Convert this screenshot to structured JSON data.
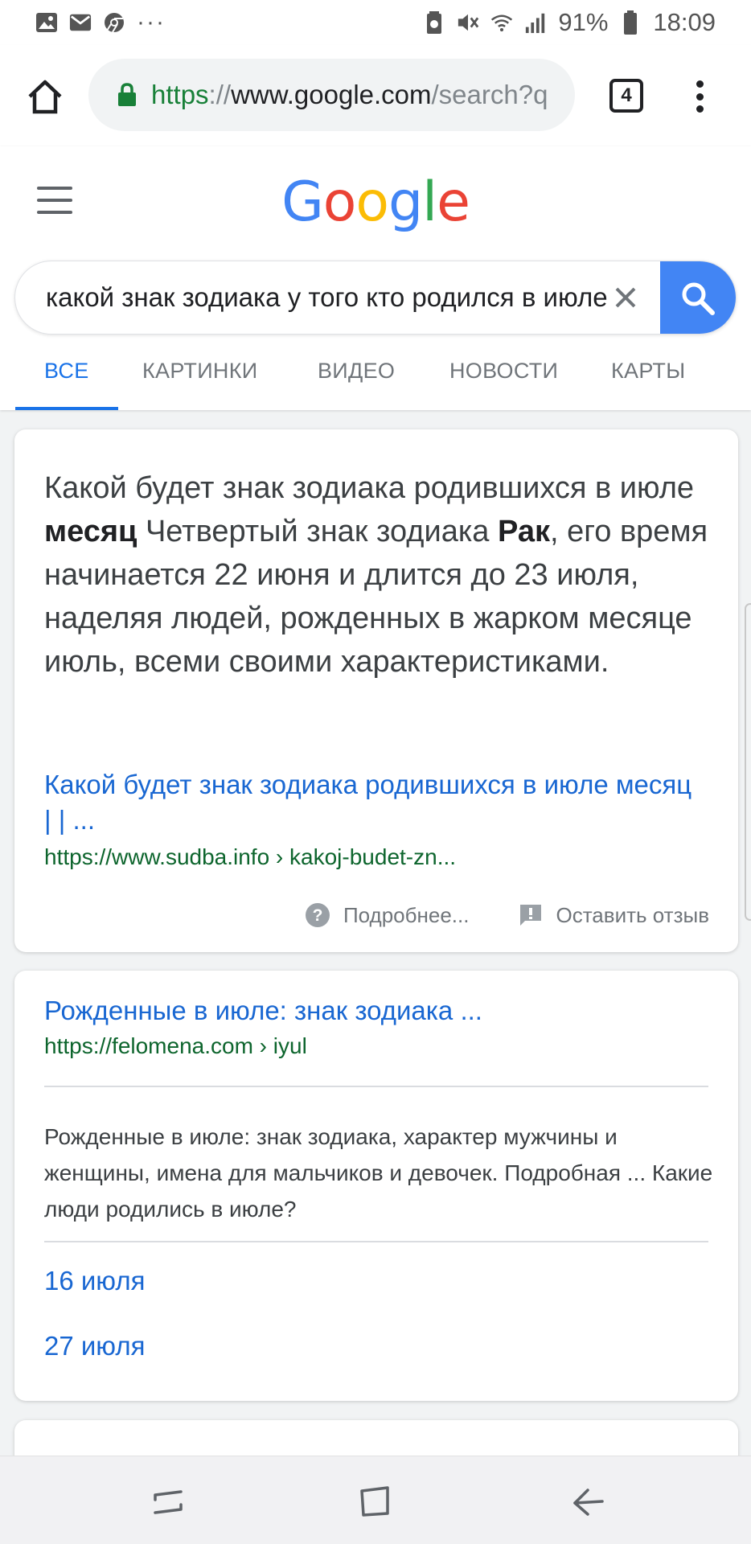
{
  "status_bar": {
    "battery_percent": "91%",
    "time": "18:09",
    "more": "···"
  },
  "browser": {
    "url_scheme": "https",
    "url_sep": "://",
    "url_host": "www.google.com",
    "url_path": "/search?q",
    "tab_count": "4"
  },
  "google": {
    "logo": [
      "G",
      "o",
      "o",
      "g",
      "l",
      "e"
    ],
    "logo_colors": [
      "#4285F4",
      "#EA4335",
      "#FBBC05",
      "#4285F4",
      "#34A853",
      "#EA4335"
    ],
    "query": "какой знак зодиака у того кто родился в июле",
    "tabs": [
      "ВСЕ",
      "КАРТИНКИ",
      "ВИДЕО",
      "НОВОСТИ",
      "КАРТЫ"
    ]
  },
  "featured": {
    "s1": "Какой будет знак зодиака родившихся в июле ",
    "b1": "месяц",
    "s2": " Четвертый знак зодиака ",
    "b2": "Рак",
    "s3": ", его время начинается 22 июня и длится до 23 июля, наделяя людей, рожденных в жарком месяце июль, всеми своими характеристиками.",
    "link_title": "Какой будет знак зодиака родившихся в июле месяц | | ...",
    "link_url": "https://www.sudba.info › kakoj-budet-zn...",
    "more_label": "Подробнее...",
    "feedback_label": "Оставить отзыв"
  },
  "result2": {
    "title": "Рожденные в июле: знак зодиака ...",
    "url": "https://felomena.com › iyul",
    "description": "Рожденные в июле: знак зодиака, характер мужчины и женщины, имена для мальчиков и девочек. Подробная ... Какие люди родились в июле?",
    "sitelinks": [
      "16 июля",
      "27 июля"
    ]
  },
  "colors": {
    "link": "#1967d2",
    "url_green": "#0d652d",
    "accent": "#1a73e8",
    "search_button": "#4285f4"
  }
}
